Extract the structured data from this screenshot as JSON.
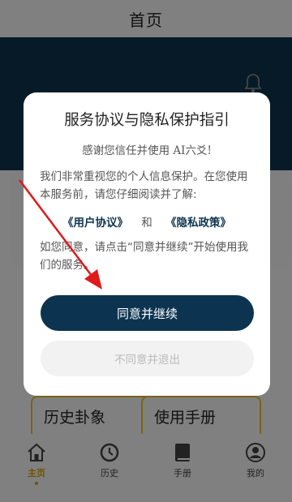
{
  "header": {
    "title": "首页"
  },
  "features": [
    "历史卦象",
    "使用手册"
  ],
  "tabs": [
    {
      "label": "主页",
      "icon": "home-icon",
      "active": true
    },
    {
      "label": "历史",
      "icon": "history-icon",
      "active": false
    },
    {
      "label": "手册",
      "icon": "book-icon",
      "active": false
    },
    {
      "label": "我的",
      "icon": "profile-icon",
      "active": false
    }
  ],
  "modal": {
    "title": "服务协议与隐私保护指引",
    "thanks": "感谢您信任并使用 AI六爻!",
    "body": "我们非常重视您的个人信息保护。在您使用本服务前，请您仔细阅读并了解:",
    "user_agreement": "《用户协议》",
    "and_text": "和",
    "privacy_policy": "《隐私政策》",
    "consent": "如您同意，请点击“同意并继续”开始使用我们的服务。",
    "agree_button": "同意并继续",
    "decline_button": "不同意并退出"
  },
  "colors": {
    "accent": "#0c3450",
    "arrow": "#e0191a",
    "active_tab": "#6b5300"
  }
}
